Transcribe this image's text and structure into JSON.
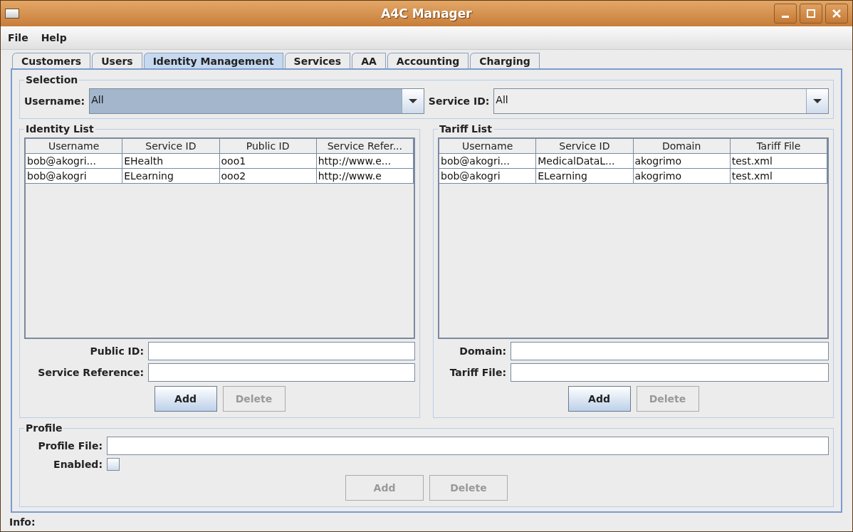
{
  "window": {
    "title": "A4C Manager"
  },
  "menu": [
    "File",
    "Help"
  ],
  "tabs": [
    {
      "label": "Customers",
      "selected": false
    },
    {
      "label": "Users",
      "selected": false
    },
    {
      "label": "Identity Management",
      "selected": true
    },
    {
      "label": "Services",
      "selected": false
    },
    {
      "label": "AA",
      "selected": false
    },
    {
      "label": "Accounting",
      "selected": false
    },
    {
      "label": "Charging",
      "selected": false
    }
  ],
  "selection": {
    "title": "Selection",
    "username": {
      "label": "Username:",
      "value": "All",
      "focused": true
    },
    "service_id": {
      "label": "Service ID:",
      "value": "All",
      "focused": false
    }
  },
  "identity_list": {
    "title": "Identity List",
    "columns": [
      "Username",
      "Service ID",
      "Public ID",
      "Service Refer..."
    ],
    "rows": [
      [
        "bob@akogri...",
        "EHealth",
        "ooo1",
        "http://www.e..."
      ],
      [
        "bob@akogri",
        "ELearning",
        "ooo2",
        "http://www.e"
      ]
    ],
    "fields": [
      {
        "label": "Public ID:"
      },
      {
        "label": "Service Reference:"
      }
    ],
    "buttons": [
      {
        "label": "Add",
        "disabled": false
      },
      {
        "label": "Delete",
        "disabled": true
      }
    ]
  },
  "tariff_list": {
    "title": "Tariff List",
    "columns": [
      "Username",
      "Service ID",
      "Domain",
      "Tariff File"
    ],
    "rows": [
      [
        "bob@akogri...",
        "MedicalDataL...",
        "akogrimo",
        "test.xml"
      ],
      [
        "bob@akogri",
        "ELearning",
        "akogrimo",
        "test.xml"
      ]
    ],
    "fields": [
      {
        "label": "Domain:"
      },
      {
        "label": "Tariff File:"
      }
    ],
    "buttons": [
      {
        "label": "Add",
        "disabled": false
      },
      {
        "label": "Delete",
        "disabled": true
      }
    ]
  },
  "profile": {
    "title": "Profile",
    "file_label": "Profile File:",
    "enabled_label": "Enabled:",
    "enabled": false,
    "buttons": [
      {
        "label": "Add",
        "disabled": true
      },
      {
        "label": "Delete",
        "disabled": true
      }
    ]
  },
  "status_bar": "Info:"
}
